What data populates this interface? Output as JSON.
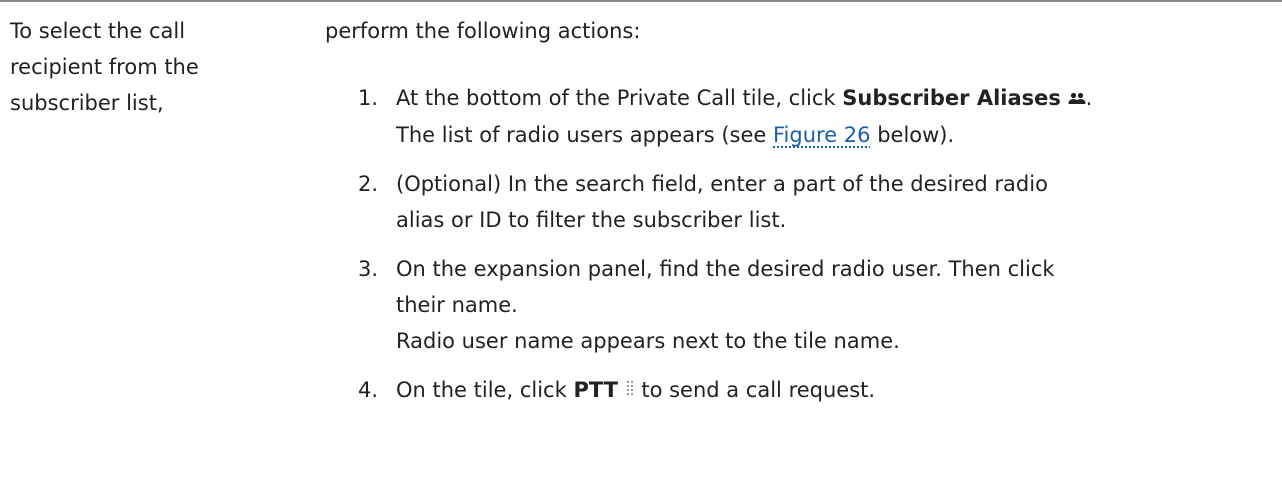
{
  "left": {
    "line1": "To select the call",
    "line2": "recipient from the",
    "line3": "subscriber list,"
  },
  "intro": "perform the following actions:",
  "steps": [
    {
      "num": "1.",
      "pre": "At the bottom of the Private Call tile, click ",
      "bold": "Subscriber Aliases",
      "post": ".",
      "line2_pre": "The list of radio users appears (see ",
      "link": "Figure 26",
      "line2_post": " below)."
    },
    {
      "num": "2.",
      "line1": "(Optional) In the search field, enter a part of the desired radio",
      "line2": "alias or ID to filter the subscriber list."
    },
    {
      "num": "3.",
      "line1": "On the expansion panel, find the desired radio user. Then click",
      "line2": "their name.",
      "line3": "Radio user name appears next to the tile name."
    },
    {
      "num": "4.",
      "pre": "On the tile, click ",
      "bold": "PTT",
      "post": " to send a call request."
    }
  ],
  "icons": {
    "subscriber_aliases": "people-icon",
    "ptt": "ptt-icon"
  }
}
